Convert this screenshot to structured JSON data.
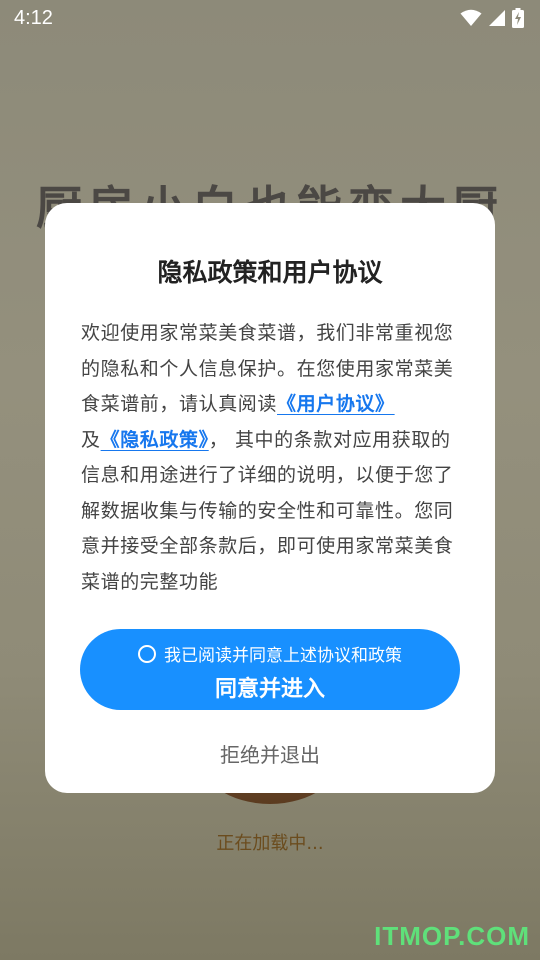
{
  "status_bar": {
    "time": "4:12",
    "icons": [
      "wifi-icon",
      "signal-icon",
      "battery-charging-icon"
    ]
  },
  "background": {
    "title": "厨房小白也能变大厨",
    "loading_text": "正在加载中...",
    "watermark": "ITMOP.COM"
  },
  "dialog": {
    "title": "隐私政策和用户协议",
    "body": {
      "intro": "欢迎使用家常菜美食菜谱，我们非常重视您的隐私和个人信息保护。在您使用家常菜美食菜谱前，请认真阅读",
      "user_agreement_link": "《用户协议》",
      "and_text": "及",
      "privacy_policy_link": "《隐私政策》",
      "rest": "， 其中的条款对应用获取的信息和用途进行了详细的说明，以便于您了解数据收集与传输的安全性和可靠性。您同意并接受全部条款后，即可使用家常菜美食菜谱的完整功能"
    },
    "checkbox_label": "我已阅读并同意上述协议和政策",
    "checkbox_checked": false,
    "agree_button": "同意并进入",
    "reject_button": "拒绝并退出"
  },
  "colors": {
    "accent": "#1890ff",
    "link": "#1677ee",
    "watermark": "#5fe07a"
  }
}
